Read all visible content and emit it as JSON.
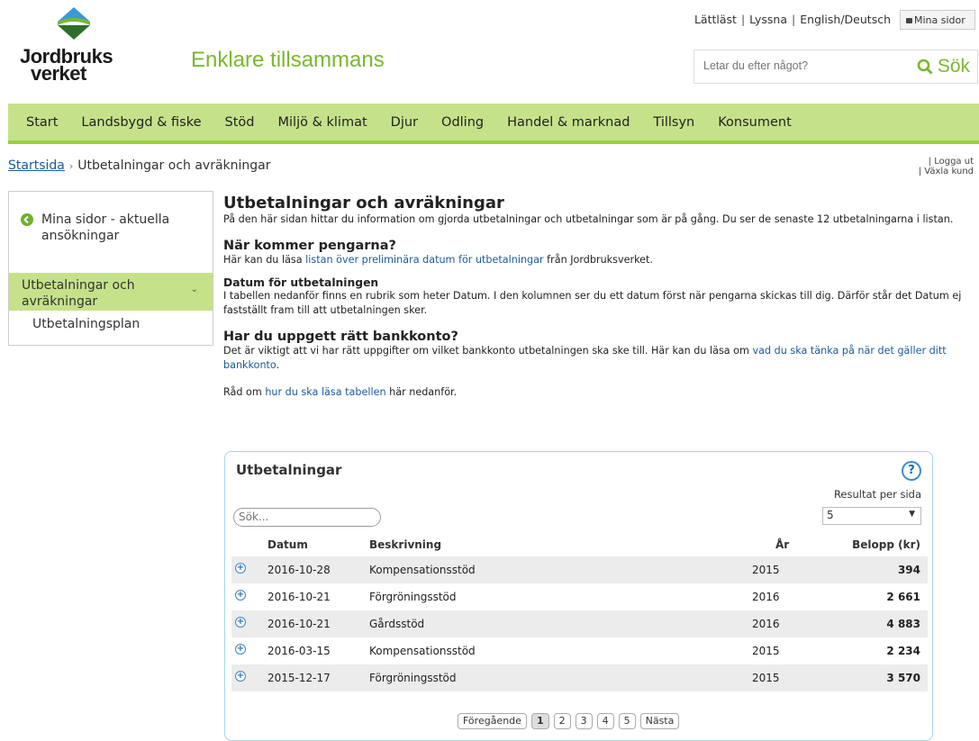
{
  "logo": {
    "line1": "Jordbruks",
    "line2": "verket"
  },
  "slogan": "Enklare tillsammans",
  "top_links": {
    "lattlast": "Lättläst",
    "lyssna": "Lyssna",
    "english": "English/Deutsch",
    "mina_sidor": "Mina sidor"
  },
  "search": {
    "placeholder": "Letar du efter något?",
    "button": "Sök"
  },
  "nav": [
    "Start",
    "Landsbygd & fiske",
    "Stöd",
    "Miljö & klimat",
    "Djur",
    "Odling",
    "Handel & marknad",
    "Tillsyn",
    "Konsument"
  ],
  "breadcrumb": {
    "home": "Startsida",
    "current": "Utbetalningar och avräkningar"
  },
  "user_links": {
    "logout": "| Logga ut",
    "switch": "| Växla kund"
  },
  "sidebar": {
    "back_label": "Mina sidor - aktuella ansökningar",
    "active_label": "Utbetalningar och avräkningar",
    "sub_label": "Utbetalningsplan"
  },
  "main": {
    "title": "Utbetalningar och avräkningar",
    "intro": "På den här sidan hittar du information om gjorda utbetalningar och utbetalningar som är på gång. Du ser de senaste 12 utbetalningarna i listan.",
    "when_title": "När kommer pengarna?",
    "when_text_before": "Här kan du läsa ",
    "when_link": "listan över preliminära datum för utbetalningar",
    "when_text_after": " från Jordbruksverket.",
    "datum_title": "Datum för utbetalningen",
    "datum_text": "I tabellen nedanför finns en rubrik som heter Datum. I den kolumnen ser du ett datum först när pengarna skickas till dig. Därför står det Datum ej fastställt fram till att utbetalningen sker.",
    "bank_title": "Har du uppgett rätt bankkonto?",
    "bank_text_before": "Det är viktigt att vi har rätt uppgifter om vilket bankkonto utbetalningen ska ske till. Här kan du läsa om ",
    "bank_link": "vad du ska tänka på när det gäller ditt bankkonto",
    "bank_text_after": ".",
    "rad_before": "Råd om ",
    "rad_link": "hur du ska läsa tabellen",
    "rad_after": " här nedanför."
  },
  "table": {
    "title": "Utbetalningar",
    "help": "?",
    "rps_label": "Resultat per sida",
    "rps_value": "5",
    "search_placeholder": "Sök...",
    "headers": {
      "date": "Datum",
      "desc": "Beskrivning",
      "year": "År",
      "amount": "Belopp (kr)"
    },
    "rows": [
      {
        "date": "2016-10-28",
        "desc": "Kompensationsstöd",
        "year": "2015",
        "amount": "394"
      },
      {
        "date": "2016-10-21",
        "desc": "Förgröningsstöd",
        "year": "2016",
        "amount": "2 661"
      },
      {
        "date": "2016-10-21",
        "desc": "Gårdsstöd",
        "year": "2016",
        "amount": "4 883"
      },
      {
        "date": "2016-03-15",
        "desc": "Kompensationsstöd",
        "year": "2015",
        "amount": "2 234"
      },
      {
        "date": "2015-12-17",
        "desc": "Förgröningsstöd",
        "year": "2015",
        "amount": "3 570"
      }
    ],
    "pager": {
      "prev": "Föregående",
      "pages": [
        "1",
        "2",
        "3",
        "4",
        "5"
      ],
      "next": "Nästa"
    }
  },
  "colors": {
    "nav_bg": "#c5e28a",
    "accent_green": "#7ab82e",
    "link": "#1a5a9a",
    "panel_border": "#a5d6ea"
  }
}
